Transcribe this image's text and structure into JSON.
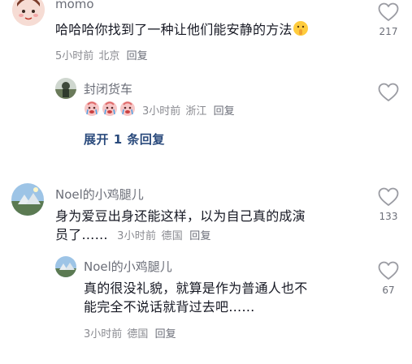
{
  "comments": [
    {
      "username": "momo",
      "text": "哈哈哈你找到了一种让他们能安静的方法",
      "time": "5小时前",
      "location": "北京",
      "reply_label": "回复",
      "likes": "217",
      "reply": {
        "username": "封闭货车",
        "time": "3小时前",
        "location": "浙江",
        "reply_label": "回复"
      },
      "expand_label": "展开 1 条回复"
    },
    {
      "username": "Noel的小鸡腿儿",
      "text_line1": "身为爱豆出身还能这样，以为自己真的成演",
      "text_line2": "员了……",
      "time": "3小时前",
      "location": "德国",
      "reply_label": "回复",
      "likes": "133",
      "reply": {
        "username": "Noel的小鸡腿儿",
        "text_line1": "真的很没礼貌，就算是作为普通人也不",
        "text_line2": "能完全不说话就背过去吧……",
        "time": "3小时前",
        "location": "德国",
        "reply_label": "回复",
        "likes": "67"
      }
    }
  ],
  "icons": {
    "like": "heart-outline-icon",
    "emoji": "shush-face-emoji",
    "reaction_emoji": "crying-face-emoji"
  },
  "colors": {
    "primary_text": "#161823",
    "secondary_text": "#8a8b91",
    "expand_link": "#2a4a7c"
  }
}
